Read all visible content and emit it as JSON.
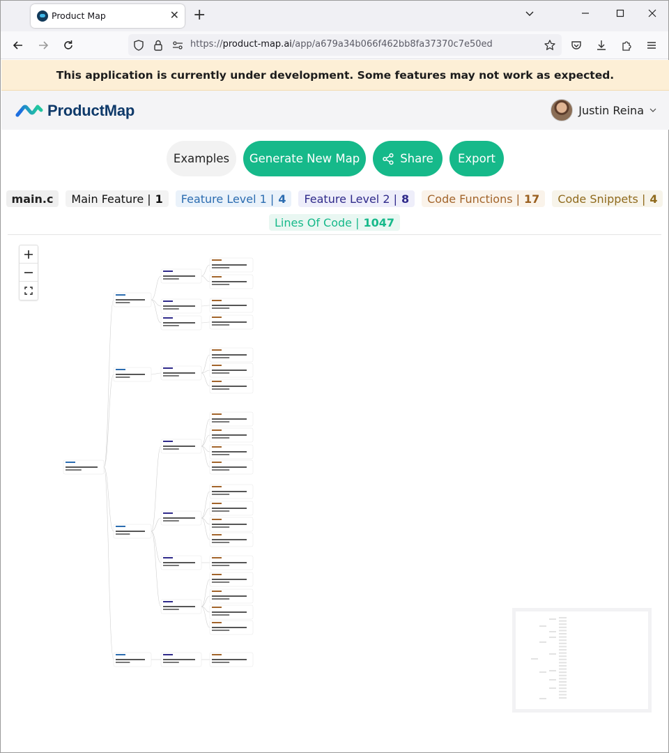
{
  "browser": {
    "tab_title": "Product Map",
    "url_prefix": "https://",
    "url_host": "product-map.ai",
    "url_path": "/app/a679a34b066f462bb8fa37370c7e50ed",
    "new_tab_symbol": "+",
    "close_symbol": "✕",
    "minimize_symbol": "─",
    "maximize_symbol": "☐",
    "window_close_symbol": "✕",
    "tab_list_symbol": "⌄"
  },
  "banner": {
    "text": "This application is currently under development. Some features may not work as expected."
  },
  "header": {
    "logo_text": "ProductMap",
    "user_name": "Justin Reina"
  },
  "toolbar": {
    "examples_label": "Examples",
    "generate_label": "Generate New Map",
    "share_label": "Share",
    "export_label": "Export"
  },
  "stats": {
    "file_name": "main.c",
    "main_feature_label": "Main Feature |",
    "main_feature_count": "1",
    "feature_l1_label": "Feature Level 1 |",
    "feature_l1_count": "4",
    "feature_l2_label": "Feature Level 2 |",
    "feature_l2_count": "8",
    "code_functions_label": "Code Functions |",
    "code_functions_count": "17",
    "code_snippets_label": "Code Snippets |",
    "code_snippets_count": "4",
    "loc_label": "Lines Of Code |",
    "loc_count": "1047"
  },
  "zoom": {
    "in_symbol": "+",
    "out_symbol": "−"
  },
  "colors": {
    "accent_green": "#16b98a",
    "banner_bg": "#fdefd6",
    "logo_blue": "#0f3a6a",
    "level1_blue": "#2b6cb0",
    "level2_indigo": "#2f2a8a",
    "function_brown": "#a2642a",
    "snippet_olive": "#8f6a1c"
  }
}
